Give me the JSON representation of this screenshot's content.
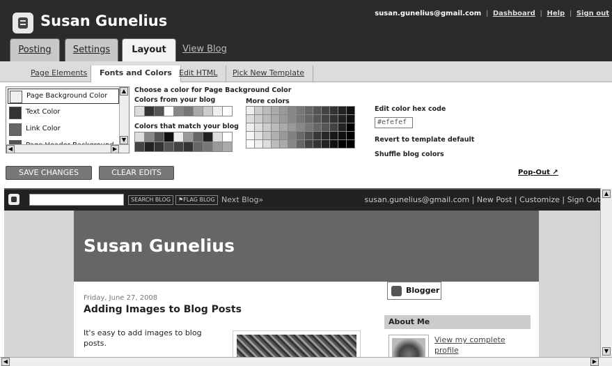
{
  "header": {
    "title": "Susan Gunelius",
    "email": "susan.gunelius@gmail.com",
    "dashboard": "Dashboard",
    "help": "Help",
    "signout": "Sign out"
  },
  "tabs": [
    {
      "label": "Posting"
    },
    {
      "label": "Settings"
    },
    {
      "label": "Layout"
    },
    {
      "label": "View Blog"
    }
  ],
  "subnav": [
    {
      "label": "Page Elements"
    },
    {
      "label": "Fonts and Colors"
    },
    {
      "label": "Edit HTML"
    },
    {
      "label": "Pick New Template"
    }
  ],
  "elements": [
    {
      "label": "Page Background Color",
      "color": "#efefef"
    },
    {
      "label": "Text Color",
      "color": "#333333"
    },
    {
      "label": "Link Color",
      "color": "#666666"
    },
    {
      "label": "Page Header Background",
      "color": "#555555"
    }
  ],
  "colors": {
    "choose_label": "Choose a color for Page Background Color",
    "from_blog": "Colors from your blog",
    "match_blog": "Colors that match your blog",
    "more": "More colors",
    "hex_label": "Edit color hex code",
    "hex_value": "#efefef",
    "revert": "Revert to template default",
    "shuffle": "Shuffle blog colors",
    "from_blog_swatches": [
      "#dddddd",
      "#333333",
      "#555555",
      "#ffffff",
      "#888888",
      "#777777",
      "#aaaaaa",
      "#cccccc",
      "#eeeeee",
      "#ffffff"
    ],
    "match_swatches": [
      "#dddddd",
      "#888888",
      "#555555",
      "#111111",
      "#eeeeee",
      "#999999",
      "#666666",
      "#222222",
      "#dddddd",
      "#ffffff",
      "#444444",
      "#222222",
      "#333333",
      "#555555",
      "#444444",
      "#333333",
      "#666666",
      "#777777",
      "#999999",
      "#aaaaaa"
    ],
    "more_swatches": [
      "#eeeeee",
      "#cccccc",
      "#bbbbbb",
      "#aaaaaa",
      "#999999",
      "#888888",
      "#777777",
      "#666666",
      "#555555",
      "#444444",
      "#333333",
      "#222222",
      "#111111",
      "#dddddd",
      "#cccccc",
      "#bbbbbb",
      "#aaaaaa",
      "#999999",
      "#888888",
      "#777777",
      "#666666",
      "#555555",
      "#444444",
      "#333333",
      "#222222",
      "#111111",
      "#eeeeee",
      "#dddddd",
      "#cccccc",
      "#bbbbbb",
      "#aaaaaa",
      "#999999",
      "#888888",
      "#777777",
      "#666666",
      "#555555",
      "#444444",
      "#222222",
      "#000000",
      "#f5f5f5",
      "#e0e0e0",
      "#c8c8c8",
      "#b0b0b0",
      "#989898",
      "#808080",
      "#686868",
      "#505050",
      "#383838",
      "#282828",
      "#181818",
      "#101010",
      "#000000",
      "#ffffff",
      "#eeeeee",
      "#dddddd",
      "#bbbbbb",
      "#aaaaaa",
      "#888888",
      "#666666",
      "#444444",
      "#333333",
      "#222222",
      "#111111",
      "#000000",
      "#000000"
    ]
  },
  "buttons": {
    "save": "SAVE CHANGES",
    "clear": "CLEAR EDITS",
    "popout": "Pop-Out"
  },
  "preview": {
    "search_btn": "SEARCH BLOG",
    "flag_btn": "FLAG BLOG",
    "next_blog": "Next Blog»",
    "nav_right": "susan.gunelius@gmail.com | New Post | Customize | Sign Out",
    "blog_title": "Susan Gunelius",
    "post_date": "Friday, June 27, 2008",
    "post_title": "Adding Images to Blog Posts",
    "post_text": "It's easy to add images to blog posts.",
    "blogger_badge": "Blogger",
    "about_me": "About Me",
    "view_profile": "View my complete profile"
  }
}
